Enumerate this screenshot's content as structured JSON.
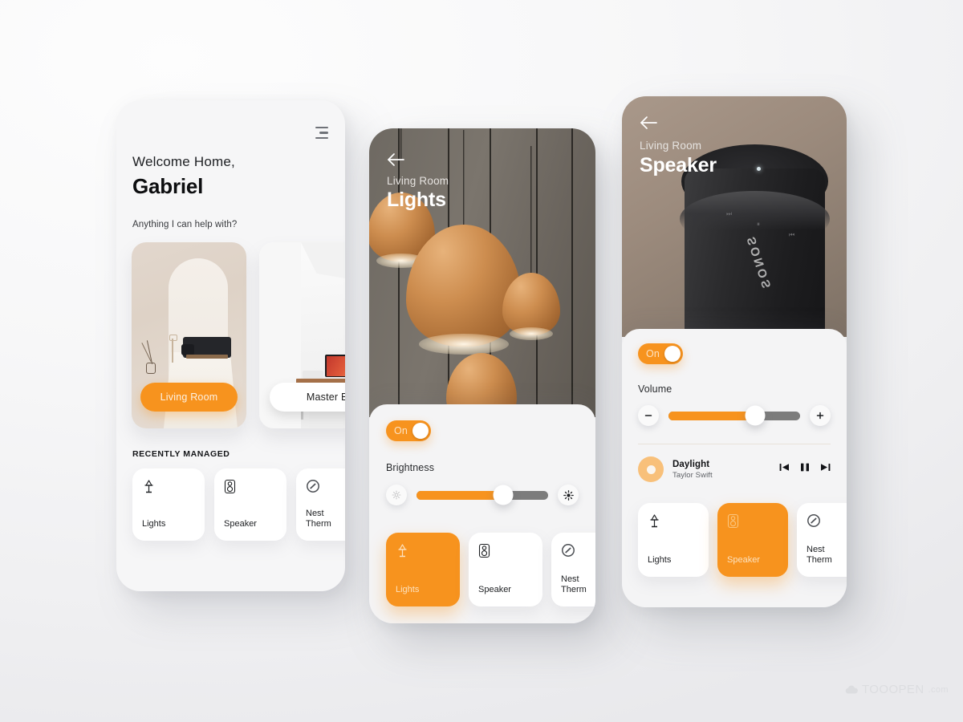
{
  "theme": {
    "accent": "#f7931e",
    "accent_text": "#fde3c3",
    "panel_bg": "#f4f4f5",
    "card_bg": "#ffffff",
    "track_bg": "#7c7c7c",
    "page_bg": "#f2f2f4"
  },
  "home": {
    "menu_icon": "hamburger-menu-icon",
    "greeting": "Welcome Home,",
    "user_name": "Gabriel",
    "prompt": "Anything I can help with?",
    "rooms": [
      {
        "label": "Living Room",
        "active": true
      },
      {
        "label": "Master Bedroom",
        "active": false
      }
    ],
    "section_label": "RECENTLY MANAGED",
    "devices": [
      {
        "label": "Lights",
        "icon": "lamp-icon",
        "active": false
      },
      {
        "label": "Speaker",
        "icon": "speaker-icon",
        "active": false
      },
      {
        "label": "Nest\nTherm",
        "icon": "thermostat-icon",
        "active": false
      }
    ]
  },
  "lights": {
    "back_icon": "back-arrow-icon",
    "breadcrumb": "Living Room",
    "title": "Lights",
    "toggle_label": "On",
    "toggle_state": "on",
    "control_label": "Brightness",
    "brightness_percent": 66,
    "low_icon": "brightness-low-icon",
    "high_icon": "brightness-high-icon",
    "devices": [
      {
        "label": "Lights",
        "icon": "lamp-icon",
        "active": true
      },
      {
        "label": "Speaker",
        "icon": "speaker-icon",
        "active": false
      },
      {
        "label": "Nest\nTherm",
        "icon": "thermostat-icon",
        "active": false
      }
    ]
  },
  "speaker": {
    "back_icon": "back-arrow-icon",
    "breadcrumb": "Living Room",
    "title": "Speaker",
    "device_brand": "SONOS",
    "toggle_label": "On",
    "toggle_state": "on",
    "control_label": "Volume",
    "volume_percent": 66,
    "minus_icon": "minus-icon",
    "plus_icon": "plus-icon",
    "now_playing": {
      "title": "Daylight",
      "artist": "Taylor Swift",
      "album_icon": "vinyl-record-icon",
      "prev_icon": "previous-track-icon",
      "play_icon": "pause-icon",
      "next_icon": "next-track-icon"
    },
    "devices": [
      {
        "label": "Lights",
        "icon": "lamp-icon",
        "active": false
      },
      {
        "label": "Speaker",
        "icon": "speaker-icon",
        "active": true
      },
      {
        "label": "Nest\nTherm",
        "icon": "thermostat-icon",
        "active": false
      }
    ]
  },
  "watermark": {
    "brand": "TOOOPEN",
    "suffix": ".com"
  }
}
